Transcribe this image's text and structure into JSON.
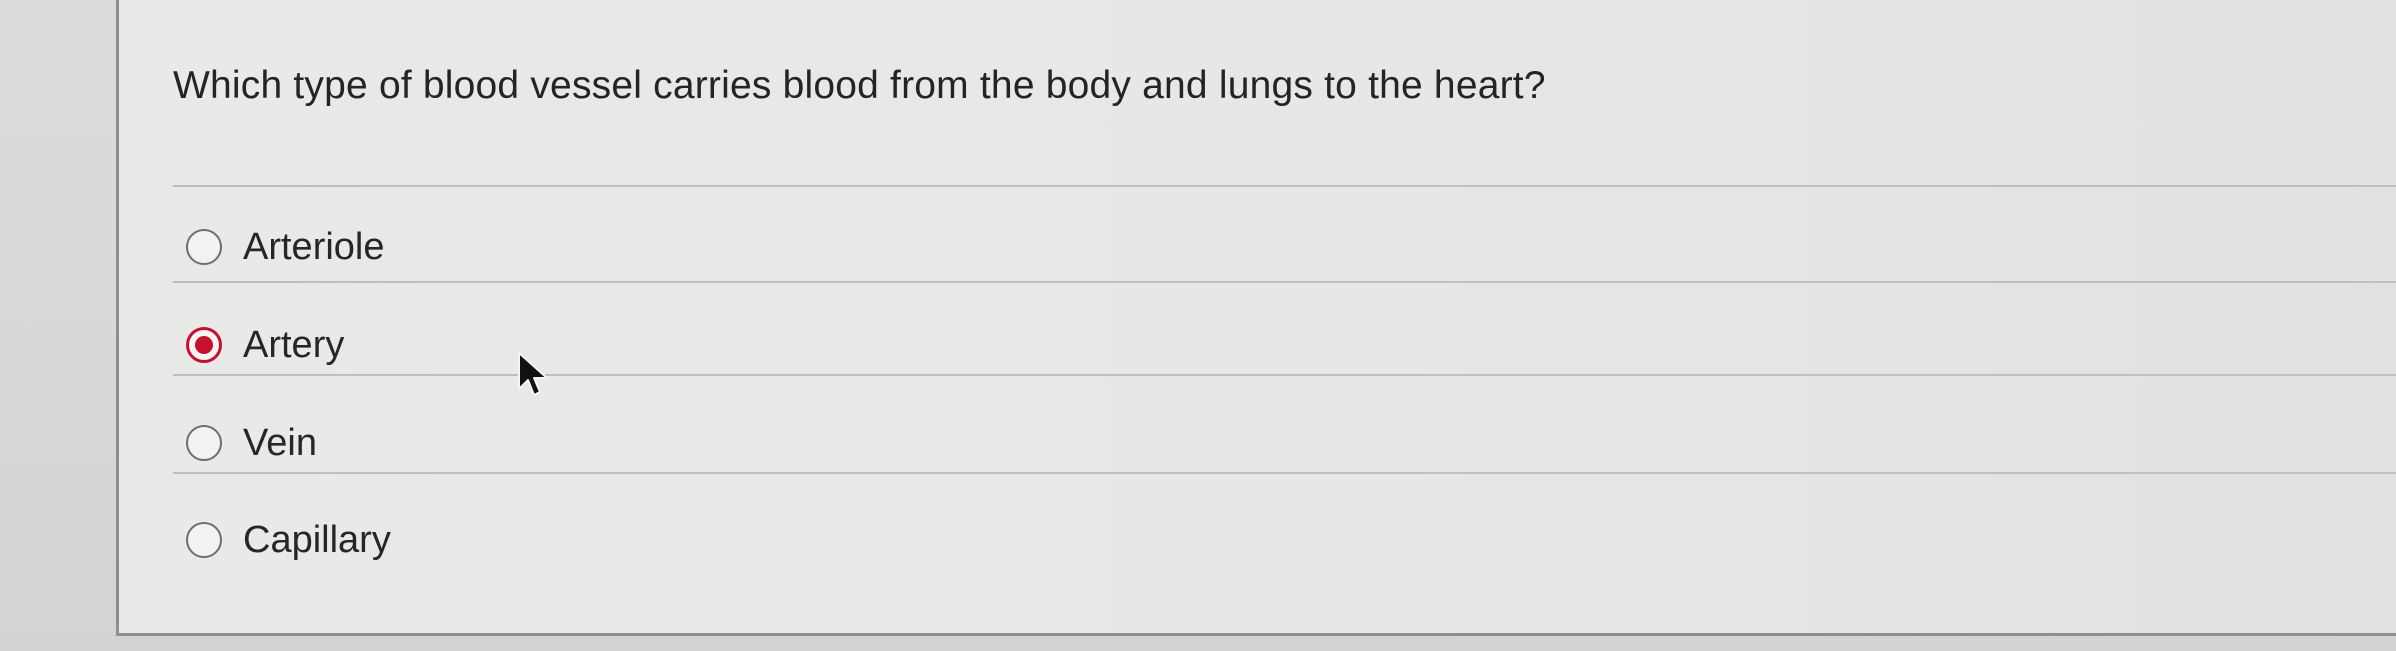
{
  "question": {
    "text": "Which type of blood vessel carries blood from the body and lungs to the heart?"
  },
  "options": [
    {
      "label": "Arteriole",
      "selected": false
    },
    {
      "label": "Artery",
      "selected": true
    },
    {
      "label": "Vein",
      "selected": false
    },
    {
      "label": "Capillary",
      "selected": false
    }
  ],
  "colors": {
    "selected_radio": "#c8102e",
    "background": "#e7e7e5"
  },
  "icons": {
    "cursor": "mouse-pointer-icon"
  }
}
